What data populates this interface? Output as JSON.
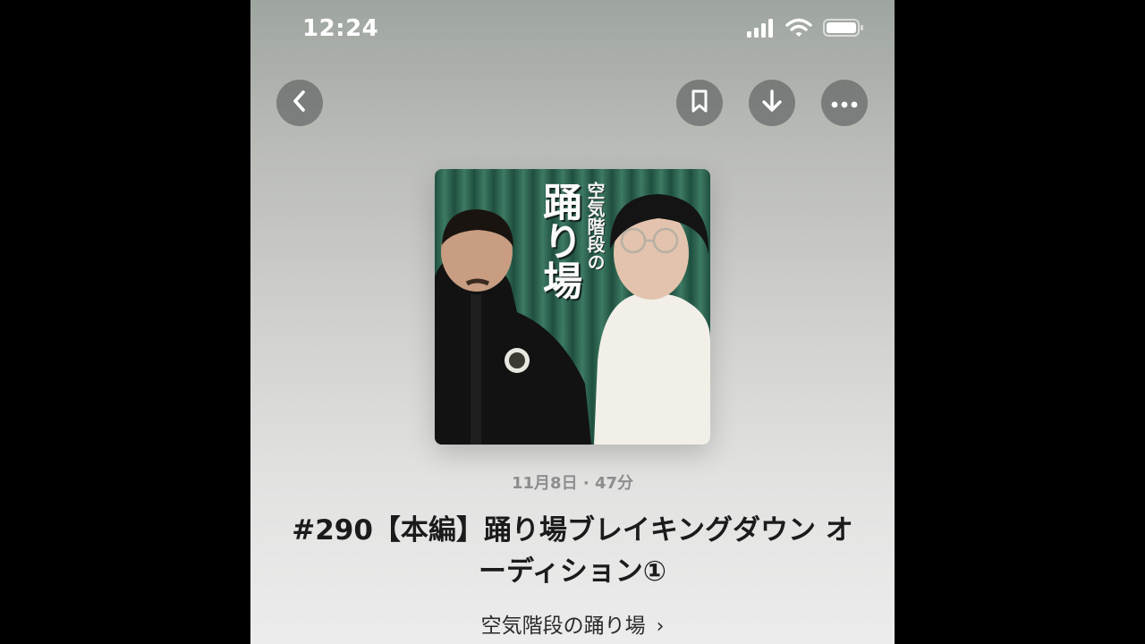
{
  "status_bar": {
    "time": "12:24",
    "icons": [
      "signal-icon",
      "wifi-icon",
      "battery-icon"
    ]
  },
  "nav": {
    "back_icon": "chevron-left-icon",
    "actions": [
      "bookmark-icon",
      "download-icon",
      "more-icon"
    ]
  },
  "artwork": {
    "title_small": "空気階段の",
    "title_big": "踊り場",
    "colors": {
      "curtain": "#2f6a55",
      "hoodie": "#111111",
      "shirt": "#f3f1ea"
    }
  },
  "episode": {
    "meta": "11月8日 · 47分",
    "title_line1": "#290【本編】踊り場ブレイキングダウン オ",
    "title_line2": "ーディション①"
  },
  "show": {
    "name": "空気階段の踊り場",
    "chevron": "›"
  }
}
